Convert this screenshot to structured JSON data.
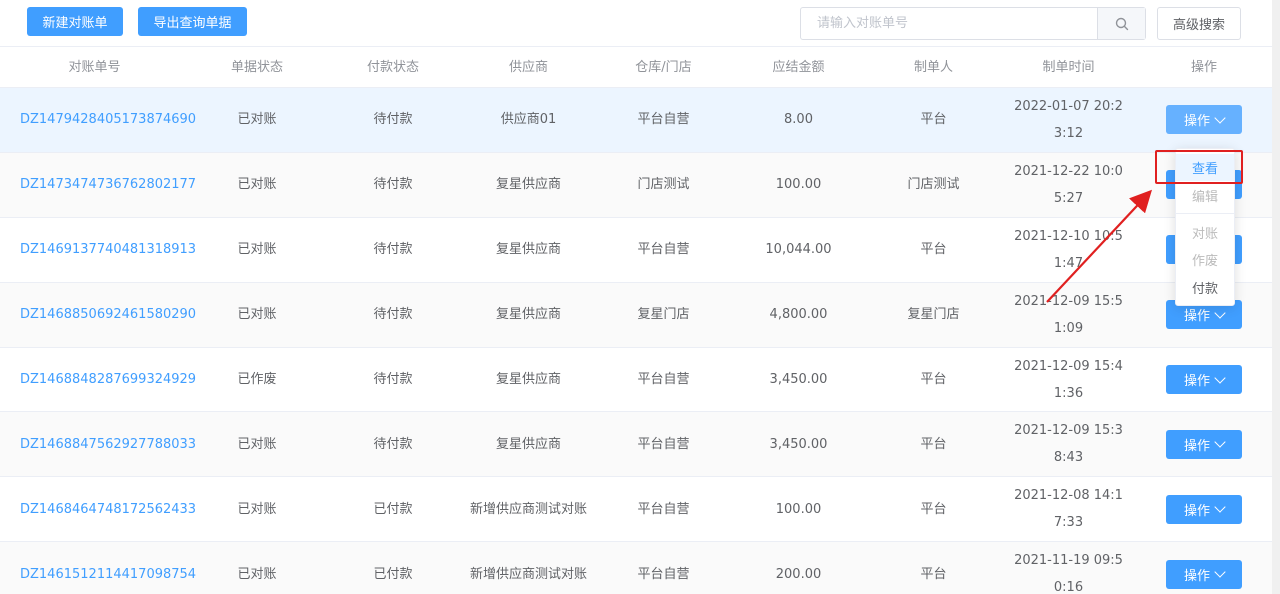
{
  "toolbar": {
    "new_label": "新建对账单",
    "export_label": "导出查询单据",
    "search_placeholder": "请输入对账单号",
    "advanced_label": "高级搜索"
  },
  "columns": [
    "对账单号",
    "单据状态",
    "付款状态",
    "供应商",
    "仓库/门店",
    "应结金额",
    "制单人",
    "制单时间",
    "操作"
  ],
  "rows": [
    {
      "code": "DZ1479428405173874690",
      "status": "已对账",
      "pay": "待付款",
      "supplier": "供应商01",
      "store": "平台自营",
      "amount": "8.00",
      "creator": "平台",
      "time": "2022-01-07 20:23:12",
      "op": "操作"
    },
    {
      "code": "DZ1473474736762802177",
      "status": "已对账",
      "pay": "待付款",
      "supplier": "复星供应商",
      "store": "门店测试",
      "amount": "100.00",
      "creator": "门店测试",
      "time": "2021-12-22 10:05:27",
      "op": "操作"
    },
    {
      "code": "DZ1469137740481318913",
      "status": "已对账",
      "pay": "待付款",
      "supplier": "复星供应商",
      "store": "平台自营",
      "amount": "10,044.00",
      "creator": "平台",
      "time": "2021-12-10 10:51:47",
      "op": "操作"
    },
    {
      "code": "DZ1468850692461580290",
      "status": "已对账",
      "pay": "待付款",
      "supplier": "复星供应商",
      "store": "复星门店",
      "amount": "4,800.00",
      "creator": "复星门店",
      "time": "2021-12-09 15:51:09",
      "op": "操作"
    },
    {
      "code": "DZ1468848287699324929",
      "status": "已作废",
      "pay": "待付款",
      "supplier": "复星供应商",
      "store": "平台自营",
      "amount": "3,450.00",
      "creator": "平台",
      "time": "2021-12-09 15:41:36",
      "op": "操作"
    },
    {
      "code": "DZ1468847562927788033",
      "status": "已对账",
      "pay": "待付款",
      "supplier": "复星供应商",
      "store": "平台自营",
      "amount": "3,450.00",
      "creator": "平台",
      "time": "2021-12-09 15:38:43",
      "op": "操作"
    },
    {
      "code": "DZ1468464748172562433",
      "status": "已对账",
      "pay": "已付款",
      "supplier": "新增供应商测试对账",
      "store": "平台自营",
      "amount": "100.00",
      "creator": "平台",
      "time": "2021-12-08 14:17:33",
      "op": "操作"
    },
    {
      "code": "DZ1461512114417098754",
      "status": "已对账",
      "pay": "已付款",
      "supplier": "新增供应商测试对账",
      "store": "平台自营",
      "amount": "200.00",
      "creator": "平台",
      "time": "2021-11-19 09:50:16",
      "op": "操作"
    }
  ],
  "dropdown": {
    "items": [
      {
        "label": "查看",
        "state": "active"
      },
      {
        "label": "编辑",
        "state": "disabled"
      },
      {
        "label": "对账",
        "state": "disabled"
      },
      {
        "label": "作废",
        "state": "disabled"
      },
      {
        "label": "付款",
        "state": "normal"
      }
    ]
  },
  "colors": {
    "primary": "#409eff",
    "link": "#409eff",
    "annotation": "#e02020"
  }
}
